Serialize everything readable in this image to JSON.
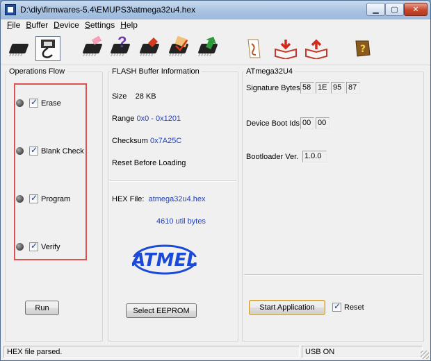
{
  "window": {
    "title": "D:\\diy\\firmwares-5.4\\EMUPS3\\atmega32u4.hex",
    "minimize_glyph": "▁",
    "maximize_glyph": "▢",
    "close_glyph": "✕"
  },
  "menu": [
    {
      "accel": "F",
      "rest": "ile"
    },
    {
      "accel": "B",
      "rest": "uffer"
    },
    {
      "accel": "D",
      "rest": "evice"
    },
    {
      "accel": "S",
      "rest": "ettings"
    },
    {
      "accel": "H",
      "rest": "elp"
    }
  ],
  "toolbar": {
    "icons": [
      "chip-device-icon",
      "usb-connect-icon",
      "chip-erase-icon",
      "chip-blank-check-icon",
      "chip-program-icon",
      "chip-verify-icon",
      "chip-read-icon",
      "chip-start-icon",
      "load-hex-file-icon",
      "open-book-icon",
      "open-book-read-icon",
      "help-book-icon"
    ]
  },
  "operations": {
    "title": "Operations Flow",
    "items": [
      {
        "label": "Erase",
        "checked": true
      },
      {
        "label": "Blank Check",
        "checked": true
      },
      {
        "label": "Program",
        "checked": true
      },
      {
        "label": "Verify",
        "checked": true
      }
    ],
    "run_label": "Run"
  },
  "flash": {
    "title": "FLASH Buffer Information",
    "size_label": "Size",
    "size_value": "28 KB",
    "range_label": "Range",
    "range_value": "0x0 - 0x1201",
    "checksum_label": "Checksum",
    "checksum_value": "0x7A25C",
    "reset_label": "Reset Before Loading",
    "hex_file_label": "HEX File:",
    "hex_file_value": "atmega32u4.hex",
    "bytes_value": "4610 util bytes",
    "logo_text": "ATMEL",
    "select_eeprom_label": "Select EEPROM"
  },
  "device": {
    "title": "ATmega32U4",
    "signature_label": "Signature Bytes",
    "signature_bytes": [
      "58",
      "1E",
      "95",
      "87"
    ],
    "boot_ids_label": "Device Boot Ids",
    "boot_ids": [
      "00",
      "00"
    ],
    "bootloader_label": "Bootloader Ver.",
    "bootloader_value": "1.0.0",
    "start_app_label": "Start Application",
    "reset_label": "Reset",
    "reset_checked": true
  },
  "status": {
    "message": "HEX file parsed.",
    "connection": "USB ON"
  },
  "colors": {
    "value_blue": "#1f3fbf",
    "atmel_blue": "#1a4ad6",
    "highlight_red": "#e15050"
  }
}
